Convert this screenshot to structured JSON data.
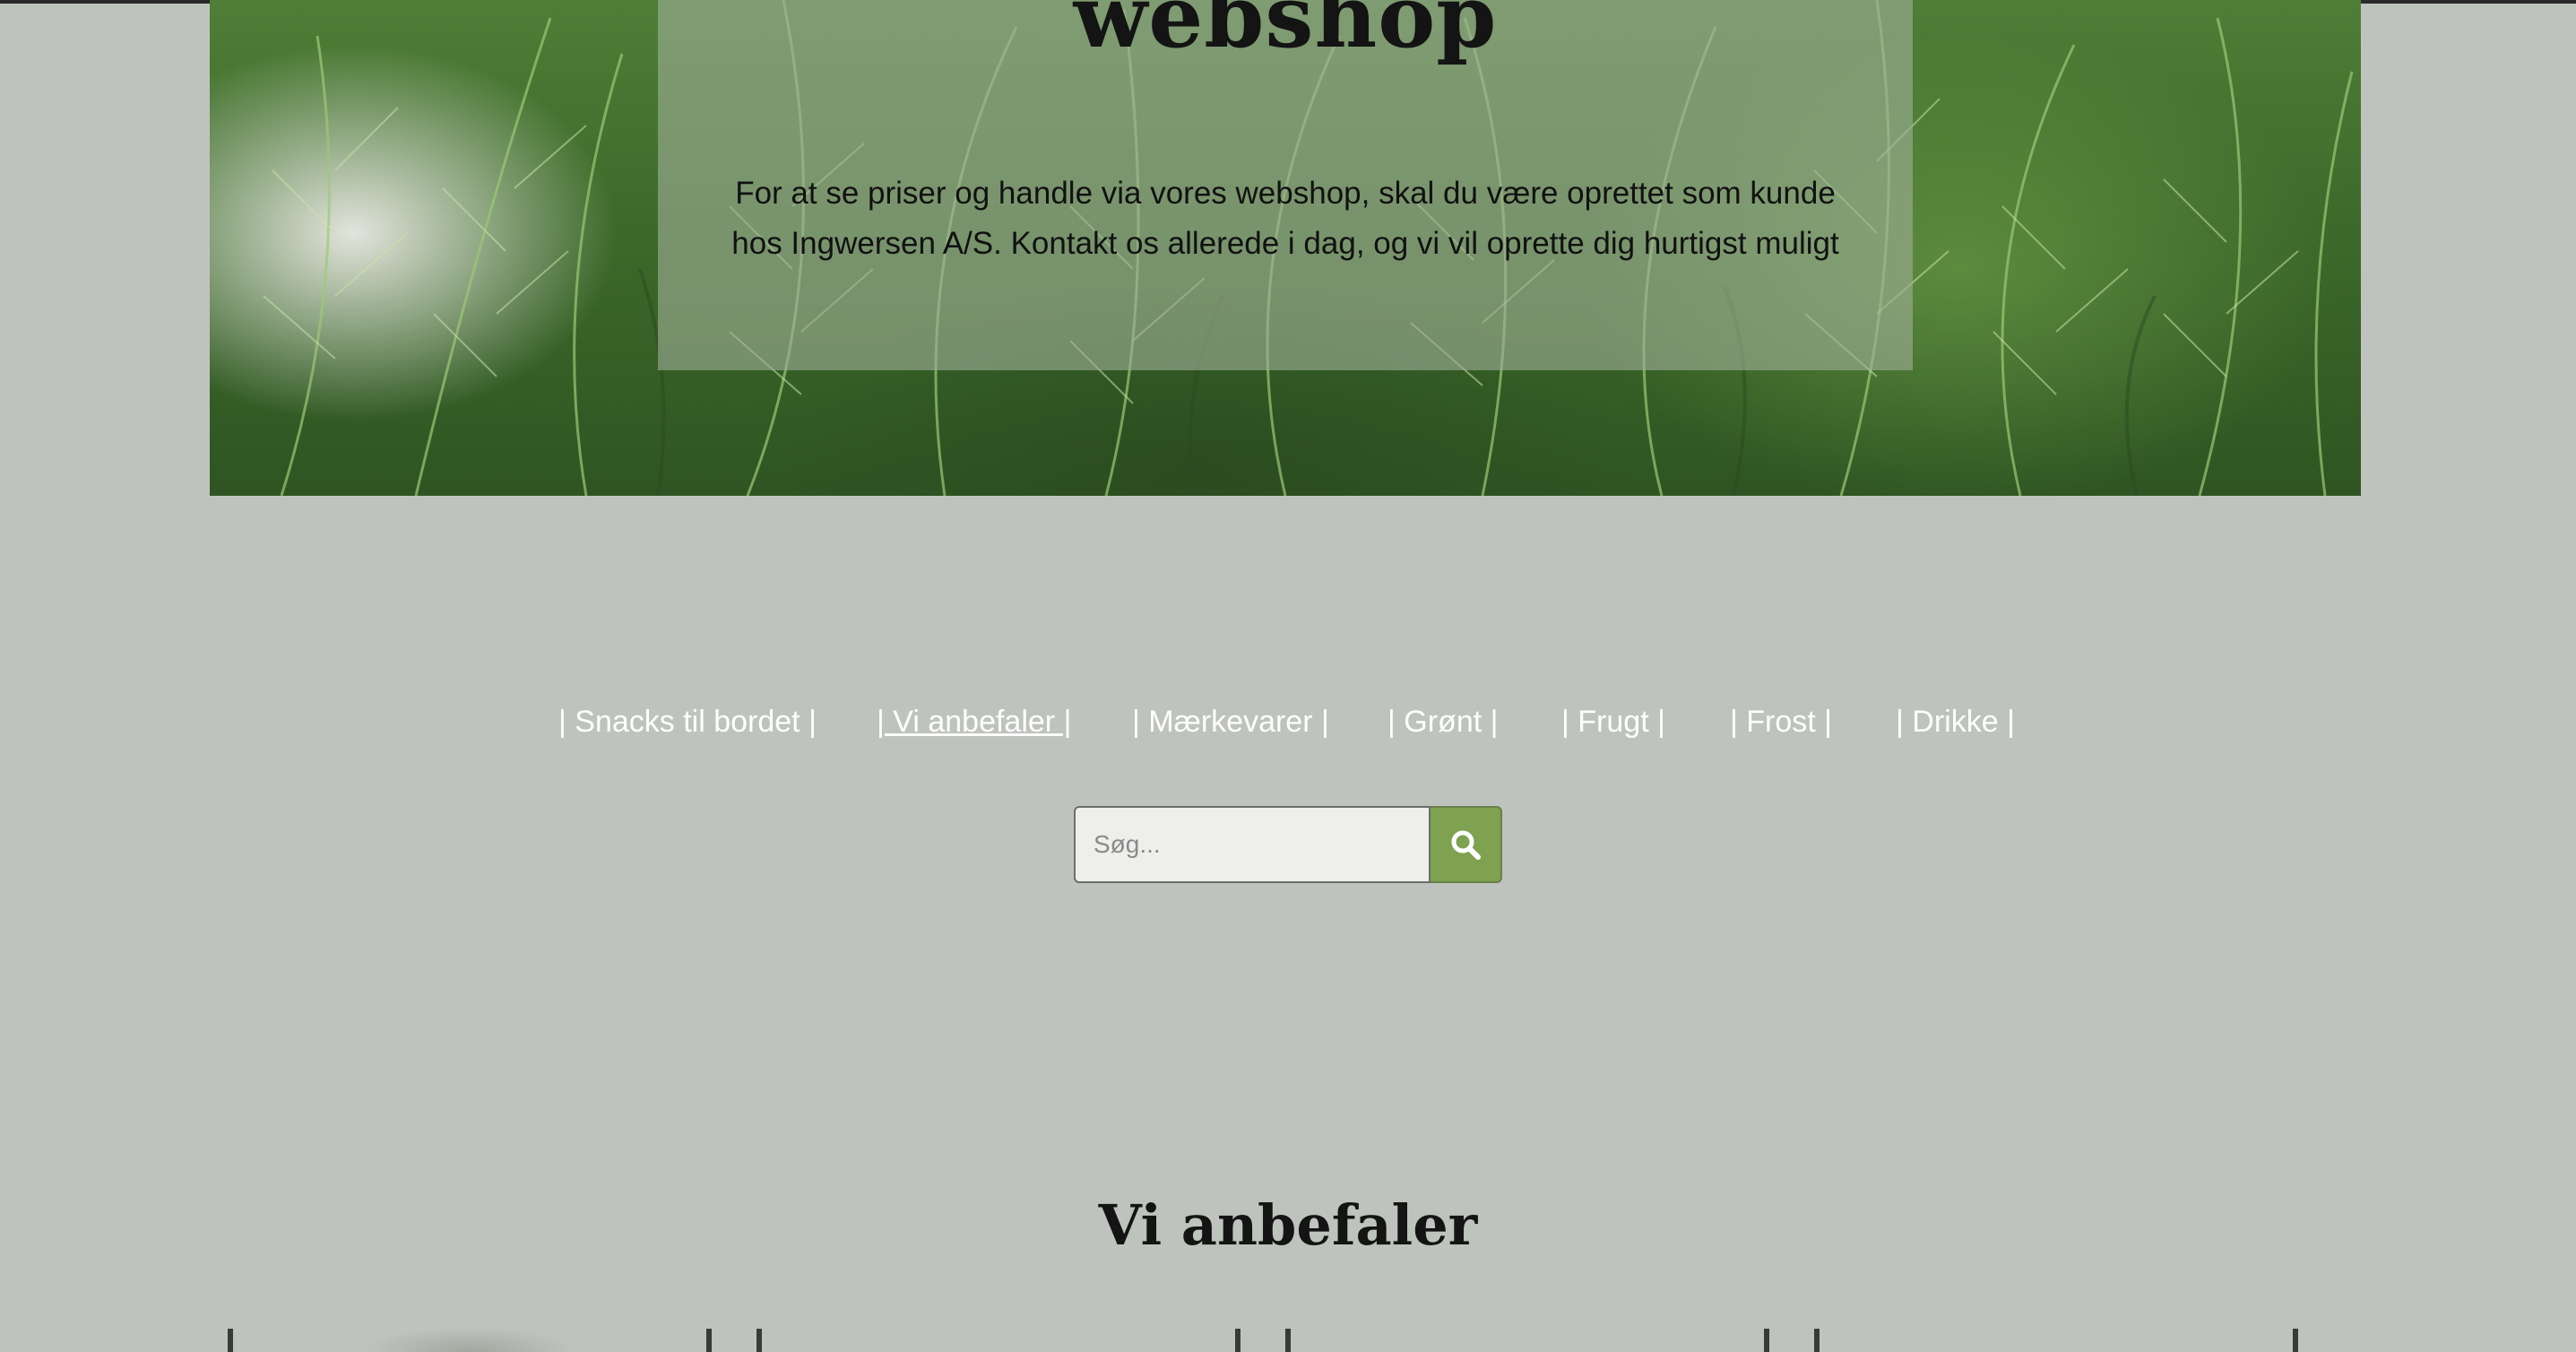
{
  "hero": {
    "title": "webshop",
    "text": "For at se priser og handle via vores webshop, skal du være oprettet som kunde hos Ingwersen A/S. Kontakt os allerede i dag, og vi vil oprette dig hurtigst muligt"
  },
  "nav": {
    "items": [
      {
        "label": "| Snacks til bordet |",
        "active": false
      },
      {
        "label": "| Vi anbefaler |",
        "active": true
      },
      {
        "label": "| Mærkevarer |",
        "active": false
      },
      {
        "label": "| Grønt |",
        "active": false
      },
      {
        "label": "| Frugt |",
        "active": false
      },
      {
        "label": "| Frost |",
        "active": false
      },
      {
        "label": "| Drikke |",
        "active": false
      }
    ]
  },
  "search": {
    "placeholder": "Søg...",
    "value": "",
    "button_icon": "search-icon"
  },
  "section": {
    "title": "Vi anbefaler"
  },
  "colors": {
    "background": "#bfc3bd",
    "accent": "#7ea250",
    "nav_text": "#ffffff"
  }
}
